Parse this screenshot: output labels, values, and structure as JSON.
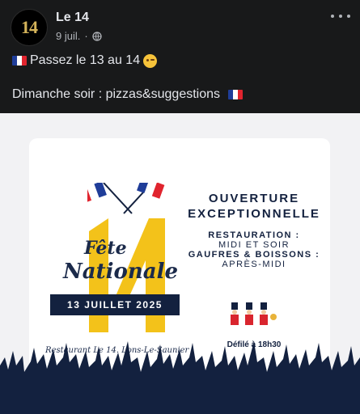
{
  "post": {
    "page_name": "Le 14",
    "date": "9 juil.",
    "separator": "·",
    "avatar_text": "14",
    "line1": "Passez le 13 au 14",
    "line2": "Dimanche soir : pizzas&suggestions"
  },
  "poster": {
    "fete_line1": "Fête",
    "fete_line2": "Nationale",
    "date_banner": "13 JUILLET 2025",
    "ouverture_line1": "OUVERTURE",
    "ouverture_line2": "EXCEPTIONNELLE",
    "restauration_label": "RESTAURATION :",
    "restauration_value": "MIDI ET SOIR",
    "gaufres_label": "GAUFRES & BOISSONS :",
    "gaufres_value": "APRÈS-MIDI",
    "defile": "Défilé à 18h30",
    "signature": "Restaurant Le 14. Lons-Le-Saunier",
    "big_number": "14"
  },
  "colors": {
    "background": "#18191a",
    "navy": "#13213f",
    "gold": "#f3c21a",
    "flag_blue": "#1f3d99",
    "flag_red": "#e0242e"
  },
  "icons": {
    "privacy": "globe-icon",
    "menu": "more-horizontal-icon",
    "emoji": "winking-face-icon",
    "flag": "france-flag-icon"
  }
}
